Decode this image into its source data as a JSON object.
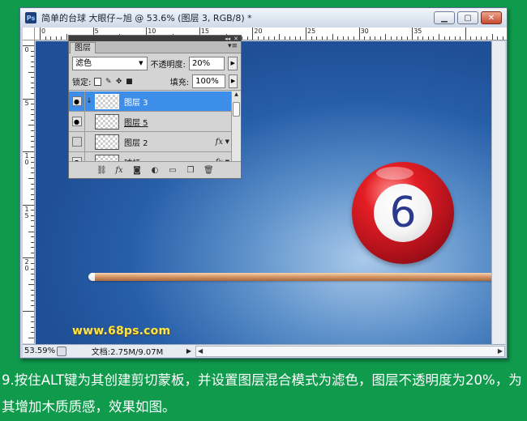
{
  "window": {
    "app_icon": "Ps",
    "title": "简单的台球  大眼仔~旭 @ 53.6% (图层 3, RGB/8) *",
    "min_glyph": "▁",
    "max_glyph": "▢",
    "close_glyph": "✕"
  },
  "ruler_h_labels": [
    "0",
    "5",
    "10",
    "15",
    "20",
    "25",
    "30",
    "35"
  ],
  "ruler_v_labels": [
    "0",
    "5",
    "1\n0",
    "1\n5",
    "2\n0"
  ],
  "layers_panel": {
    "tab_label": "图层",
    "blend_mode": "滤色",
    "opacity_label": "不透明度:",
    "opacity_value": "20%",
    "lock_label": "锁定:",
    "fill_label": "填充:",
    "fill_value": "100%",
    "layers": [
      {
        "name": "图层 3",
        "visible": true,
        "active": true,
        "clipped": true,
        "fx": false
      },
      {
        "name": "图层 5",
        "visible": true,
        "active": false,
        "clipped": false,
        "fx": false
      },
      {
        "name": "图层 2",
        "visible": false,
        "active": false,
        "clipped": false,
        "fx": true
      },
      {
        "name": "球杆",
        "visible": true,
        "active": false,
        "clipped": false,
        "fx": true
      }
    ],
    "fx_label": "fx"
  },
  "canvas": {
    "ball_number": "6",
    "watermark": "www.68ps.com"
  },
  "status": {
    "zoom": "53.59%",
    "doc_info": "文档:2.75M/9.07M"
  },
  "caption": "9.按住ALT键为其创建剪切蒙板，并设置图层混合模式为滤色，图层不透明度为20%，为其增加木质质感，效果如图。",
  "colors": {
    "page_background": "#0f9a4c",
    "active_layer": "#3d8ee8",
    "ball_red": "#e31e24",
    "ball_number": "#2a3a8e",
    "watermark": "#ffe34a"
  }
}
